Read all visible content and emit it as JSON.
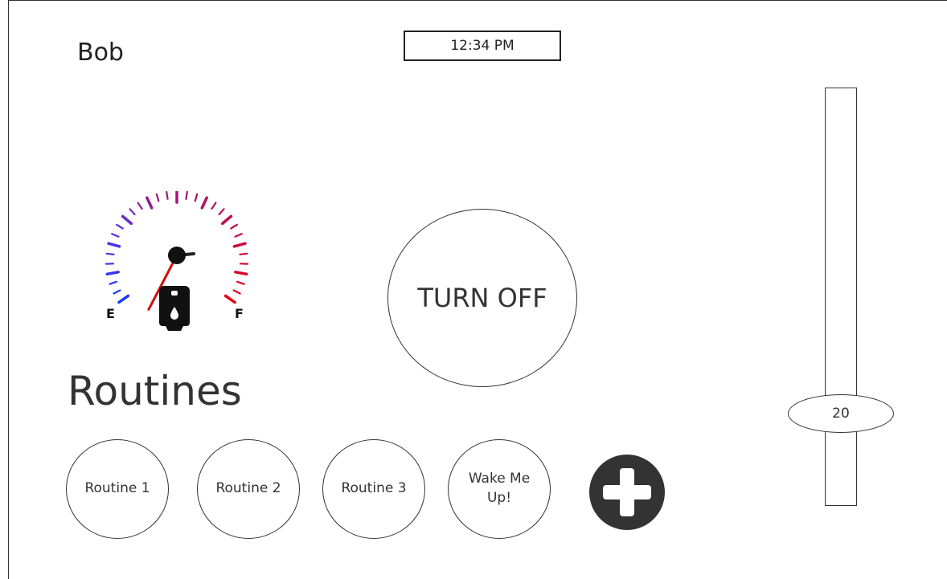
{
  "header": {
    "user_name": "Bob",
    "clock": "12:34 PM"
  },
  "gauge": {
    "empty_label": "E",
    "full_label": "F",
    "level": 0.03,
    "icon": "fuel-pump-icon"
  },
  "power_button": {
    "label": "TURN OFF"
  },
  "routines": {
    "title": "Routines",
    "items": [
      {
        "label": "Routine 1"
      },
      {
        "label": "Routine 2"
      },
      {
        "label": "Routine 3"
      },
      {
        "label": "Wake Me Up!"
      }
    ],
    "add_icon": "plus-icon"
  },
  "slider": {
    "value": "20",
    "min": 0,
    "max": 100,
    "fraction": 0.22
  },
  "colors": {
    "ink": "#333333",
    "needle": "#cc1111",
    "tick_empty": "#1a3aff",
    "tick_full": "#e00000"
  }
}
